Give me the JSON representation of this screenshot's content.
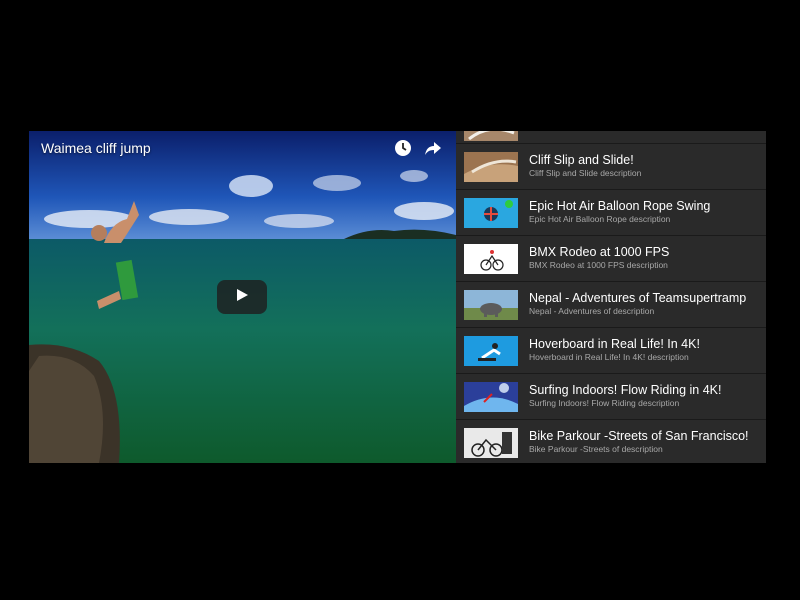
{
  "video": {
    "title": "Waimea cliff jump",
    "icons": [
      "clock-icon",
      "share-icon",
      "play-icon"
    ]
  },
  "playlist": {
    "items": [
      {
        "title": "Cliff Slip and Slide!",
        "description": "Cliff Slip and Slide description"
      },
      {
        "title": "Epic Hot Air Balloon Rope Swing",
        "description": "Epic Hot Air Balloon Rope description"
      },
      {
        "title": "BMX Rodeo at 1000 FPS",
        "description": "BMX Rodeo at 1000 FPS description"
      },
      {
        "title": "Nepal - Adventures of Teamsupertramp",
        "description": "Nepal - Adventures of description"
      },
      {
        "title": "Hoverboard in Real Life! In 4K!",
        "description": "Hoverboard in Real Life! In 4K! description"
      },
      {
        "title": "Surfing Indoors! Flow Riding in 4K!",
        "description": "Surfing Indoors! Flow Riding description"
      },
      {
        "title": "Bike Parkour -Streets of San Francisco!",
        "description": "Bike Parkour -Streets of description"
      }
    ]
  }
}
